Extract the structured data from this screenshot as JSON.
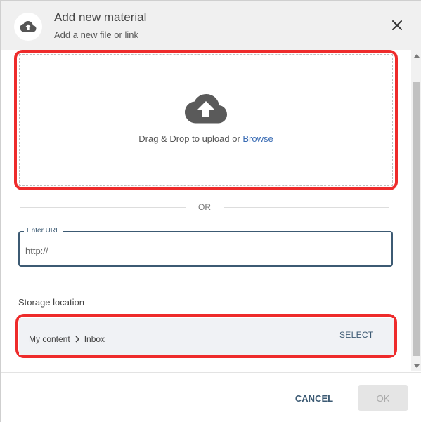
{
  "dialog": {
    "title": "Add new material",
    "subtitle": "Add a new file or link",
    "header_icon": "cloud-upload-icon",
    "close_icon": "close-icon"
  },
  "upload": {
    "icon": "cloud-upload-icon",
    "drop_text": "Drag & Drop to upload or ",
    "browse_label": "Browse"
  },
  "divider": {
    "label": "OR"
  },
  "url": {
    "label": "Enter URL",
    "placeholder": "http://",
    "value": ""
  },
  "storage": {
    "label": "Storage location",
    "path": [
      "My content",
      "Inbox"
    ],
    "separator_icon": "chevron-right-icon",
    "select_label": "SELECT"
  },
  "footer": {
    "cancel_label": "CANCEL",
    "ok_label": "OK"
  },
  "colors": {
    "highlight": "#ee2b2b",
    "accent": "#3c5a73",
    "link": "#3a6cb4",
    "disabled_bg": "#e5e5e5"
  }
}
